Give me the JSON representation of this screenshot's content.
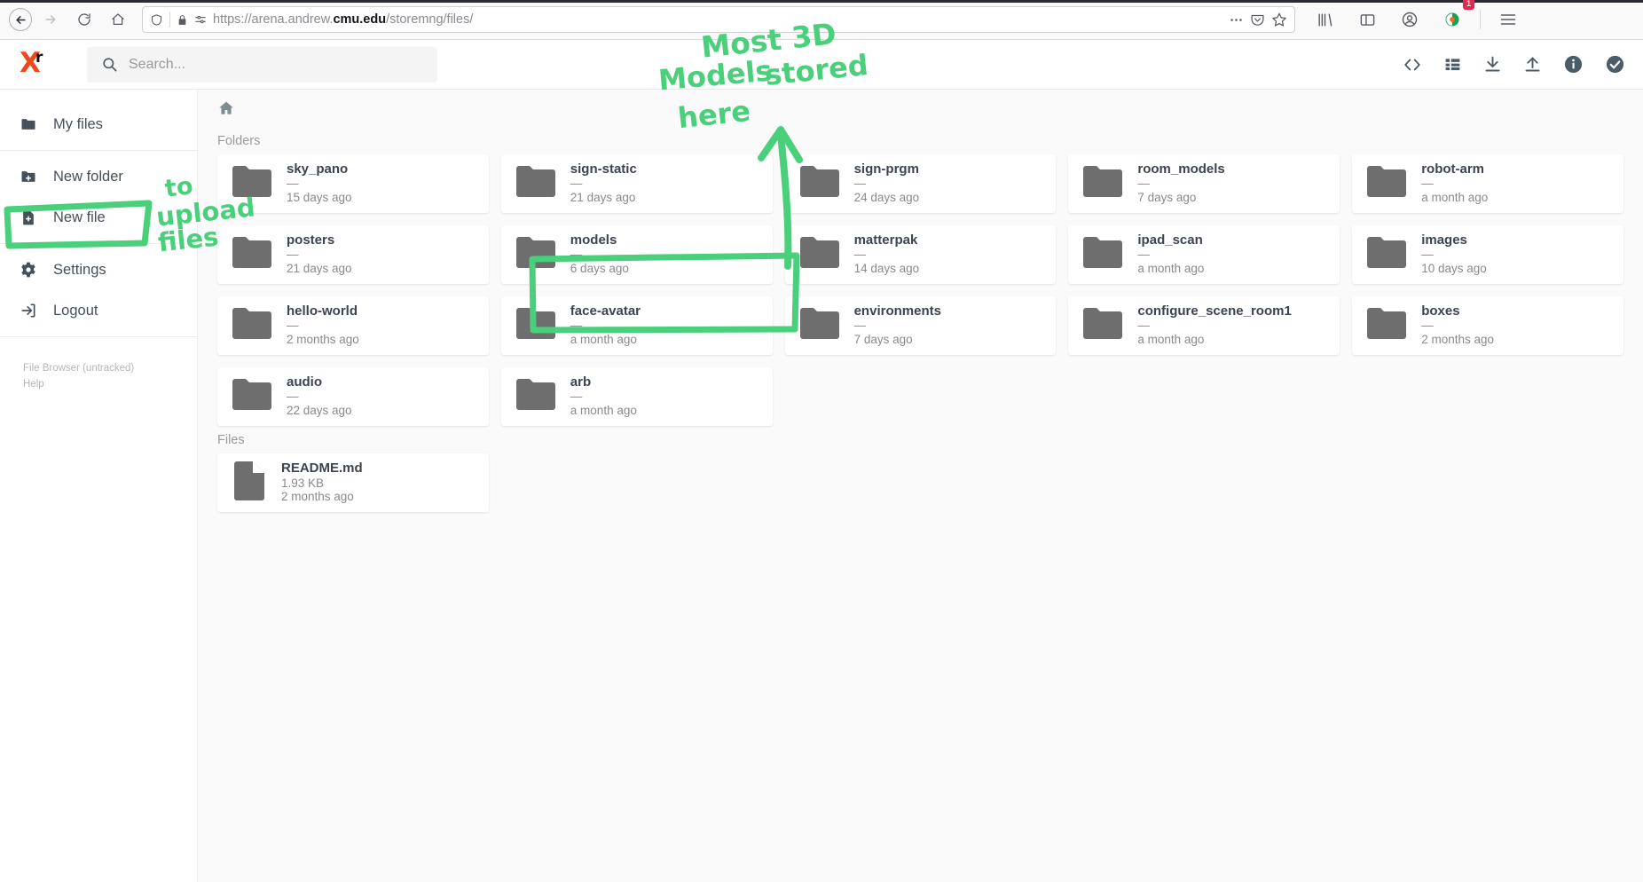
{
  "browser": {
    "url_scheme": "https://",
    "url_host_pre": "arena.andrew.",
    "url_host_bold": "cmu.edu",
    "url_path": "/storemng/files/",
    "back_icon": "back-arrow-icon",
    "forward_icon": "forward-arrow-icon",
    "reload_icon": "reload-icon",
    "home_icon": "home-icon",
    "shield_icon": "shield-icon",
    "lock_icon": "lock-icon",
    "permissions_icon": "permissions-icon",
    "more_icon": "page-actions-icon",
    "pocket_icon": "pocket-icon",
    "bookmark_icon": "bookmark-star-icon",
    "library_icon": "library-icon",
    "sidebar_icon": "sidebar-toggle-icon",
    "account_icon": "account-icon",
    "extension_icon": "extension-icon",
    "extension_badge": "1",
    "menu_icon": "hamburger-menu-icon"
  },
  "app": {
    "logo_x": "X",
    "logo_r": "r",
    "search_placeholder": "Search...",
    "actions": [
      {
        "name": "code-icon",
        "label": "Code"
      },
      {
        "name": "list-view-icon",
        "label": "List view"
      },
      {
        "name": "download-icon",
        "label": "Download"
      },
      {
        "name": "upload-icon",
        "label": "Upload"
      },
      {
        "name": "info-icon",
        "label": "Info"
      },
      {
        "name": "select-check-icon",
        "label": "Select"
      }
    ]
  },
  "sidebar": {
    "groups": [
      {
        "items": [
          {
            "label": "My files",
            "icon": "folder-icon"
          }
        ]
      },
      {
        "items": [
          {
            "label": "New folder",
            "icon": "folder-plus-icon"
          },
          {
            "label": "New file",
            "icon": "file-plus-icon"
          }
        ]
      },
      {
        "items": [
          {
            "label": "Settings",
            "icon": "gear-icon"
          },
          {
            "label": "Logout",
            "icon": "logout-icon"
          }
        ]
      }
    ],
    "footer": {
      "version": "File Browser (untracked)",
      "help": "Help"
    }
  },
  "main": {
    "breadcrumb_home": "home-icon",
    "folders_label": "Folders",
    "files_label": "Files",
    "folders": [
      {
        "name": "sky_pano",
        "size": "—",
        "date": "15 days ago"
      },
      {
        "name": "sign-static",
        "size": "—",
        "date": "21 days ago"
      },
      {
        "name": "sign-prgm",
        "size": "—",
        "date": "24 days ago"
      },
      {
        "name": "room_models",
        "size": "—",
        "date": "7 days ago"
      },
      {
        "name": "robot-arm",
        "size": "—",
        "date": "a month ago"
      },
      {
        "name": "posters",
        "size": "—",
        "date": "21 days ago"
      },
      {
        "name": "models",
        "size": "—",
        "date": "6 days ago"
      },
      {
        "name": "matterpak",
        "size": "—",
        "date": "14 days ago"
      },
      {
        "name": "ipad_scan",
        "size": "—",
        "date": "a month ago"
      },
      {
        "name": "images",
        "size": "—",
        "date": "10 days ago"
      },
      {
        "name": "hello-world",
        "size": "—",
        "date": "2 months ago"
      },
      {
        "name": "face-avatar",
        "size": "—",
        "date": "a month ago"
      },
      {
        "name": "environments",
        "size": "—",
        "date": "7 days ago"
      },
      {
        "name": "configure_scene_room1",
        "size": "—",
        "date": "a month ago"
      },
      {
        "name": "boxes",
        "size": "—",
        "date": "2 months ago"
      },
      {
        "name": "audio",
        "size": "—",
        "date": "22 days ago"
      },
      {
        "name": "arb",
        "size": "—",
        "date": "a month ago"
      }
    ],
    "files": [
      {
        "name": "README.md",
        "size": "1.93 KB",
        "date": "2 months ago"
      }
    ]
  },
  "annotations": {
    "color": "#4ad07a",
    "note_upload_line1": "to",
    "note_upload_line2": "upload",
    "note_upload_line3": "files",
    "note_models_line1": "Most 3D",
    "note_models_line2": "Models",
    "note_models_line3": "stored",
    "note_models_line4": "here"
  }
}
